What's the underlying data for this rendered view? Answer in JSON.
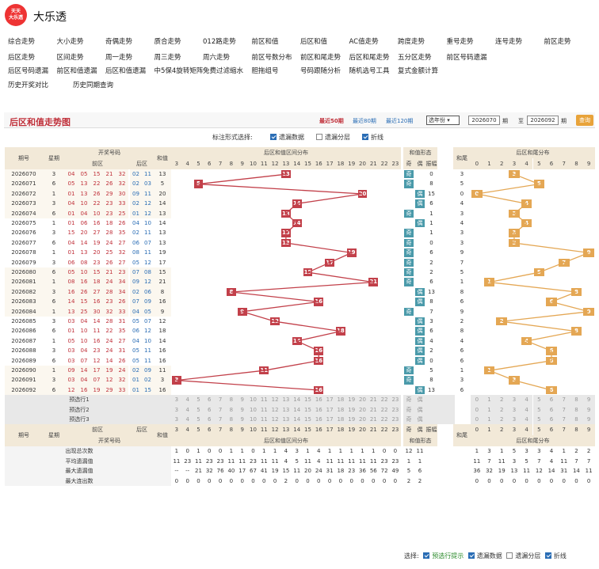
{
  "site": {
    "logo_lines": [
      "天天",
      "大乐透"
    ],
    "name": "大乐透"
  },
  "nav": [
    [
      "综合走势",
      "大小走势",
      "奇偶走势",
      "质合走势",
      "012路走势",
      "前区和值",
      "后区和值",
      "AC值走势",
      "跨度走势",
      "重号走势",
      "连号走势",
      "前区走势"
    ],
    [
      "后区走势",
      "区间走势",
      "周一走势",
      "周三走势",
      "周六走势",
      "前区号数分布",
      "前区和尾走势",
      "后区和尾走势",
      "五分区走势",
      "前区号码遗漏"
    ],
    [
      "后区号码遗漏",
      "前区和值遗漏",
      "后区和值遗漏",
      "中5保4旋转矩阵",
      "免费过滤缩水",
      "胆拖组号",
      "号码跟随分析",
      "随机选号工具",
      "复式金额计算"
    ],
    [
      "历史开奖对比",
      "历史同期查询"
    ]
  ],
  "title": "后区和值走势图",
  "period_tabs": [
    "最近50期",
    "最近80期",
    "最近120期"
  ],
  "year_select": "选年份",
  "range": {
    "from": "2026070",
    "sep1": "期",
    "to_label": "至",
    "to": "2026092",
    "sep2": "期",
    "query": "查询"
  },
  "options": {
    "label": "标注形式选择:",
    "items": [
      {
        "label": "遗漏数据",
        "checked": true
      },
      {
        "label": "遗漏分层",
        "checked": false
      },
      {
        "label": "折线",
        "checked": true
      }
    ]
  },
  "headers": {
    "period": "期号",
    "week": "星期",
    "kaijiang": "开奖号码",
    "front": "前区",
    "back": "后区",
    "sum": "和值",
    "dist": "后区和值区间分布",
    "shape": "和值形态",
    "odd": "奇",
    "even": "偶",
    "amp": "振幅",
    "tail": "和尾",
    "taildist": "后区和尾分布"
  },
  "dist_nums": [
    "3",
    "4",
    "5",
    "6",
    "7",
    "8",
    "9",
    "10",
    "11",
    "12",
    "13",
    "14",
    "15",
    "16",
    "17",
    "18",
    "19",
    "20",
    "21",
    "22",
    "23"
  ],
  "tail_nums": [
    "0",
    "1",
    "2",
    "3",
    "4",
    "5",
    "6",
    "7",
    "8",
    "9"
  ],
  "rows": [
    {
      "p": "2026070",
      "w": "3",
      "f": [
        "04",
        "05",
        "15",
        "21",
        "32"
      ],
      "b": [
        "02",
        "11"
      ],
      "s": 13,
      "amp": "0",
      "tail": "3"
    },
    {
      "p": "2026071",
      "w": "6",
      "f": [
        "05",
        "13",
        "22",
        "26",
        "32"
      ],
      "b": [
        "02",
        "03"
      ],
      "s": 5,
      "amp": "8",
      "tail": "5"
    },
    {
      "p": "2026072",
      "w": "1",
      "f": [
        "01",
        "13",
        "26",
        "29",
        "30"
      ],
      "b": [
        "09",
        "11"
      ],
      "s": 20,
      "amp": "15",
      "tail": "0"
    },
    {
      "p": "2026073",
      "w": "3",
      "f": [
        "04",
        "10",
        "22",
        "23",
        "33"
      ],
      "b": [
        "02",
        "12"
      ],
      "s": 14,
      "amp": "6",
      "tail": "4"
    },
    {
      "p": "2026074",
      "w": "6",
      "f": [
        "01",
        "04",
        "10",
        "23",
        "25"
      ],
      "b": [
        "01",
        "12"
      ],
      "s": 13,
      "amp": "1",
      "tail": "3"
    },
    {
      "p": "2026075",
      "w": "1",
      "f": [
        "01",
        "06",
        "16",
        "18",
        "26"
      ],
      "b": [
        "04",
        "10"
      ],
      "s": 14,
      "amp": "1",
      "tail": "4"
    },
    {
      "p": "2026076",
      "w": "3",
      "f": [
        "15",
        "20",
        "27",
        "28",
        "35"
      ],
      "b": [
        "02",
        "11"
      ],
      "s": 13,
      "amp": "1",
      "tail": "3"
    },
    {
      "p": "2026077",
      "w": "6",
      "f": [
        "04",
        "14",
        "19",
        "24",
        "27"
      ],
      "b": [
        "06",
        "07"
      ],
      "s": 13,
      "amp": "0",
      "tail": "3"
    },
    {
      "p": "2026078",
      "w": "1",
      "f": [
        "01",
        "13",
        "20",
        "25",
        "32"
      ],
      "b": [
        "08",
        "11"
      ],
      "s": 19,
      "amp": "6",
      "tail": "9"
    },
    {
      "p": "2026079",
      "w": "3",
      "f": [
        "06",
        "08",
        "23",
        "26",
        "27"
      ],
      "b": [
        "05",
        "12"
      ],
      "s": 17,
      "amp": "2",
      "tail": "7"
    },
    {
      "p": "2026080",
      "w": "6",
      "f": [
        "05",
        "10",
        "15",
        "21",
        "23"
      ],
      "b": [
        "07",
        "08"
      ],
      "s": 15,
      "amp": "2",
      "tail": "5"
    },
    {
      "p": "2026081",
      "w": "1",
      "f": [
        "08",
        "16",
        "18",
        "24",
        "34"
      ],
      "b": [
        "09",
        "12"
      ],
      "s": 21,
      "amp": "6",
      "tail": "1"
    },
    {
      "p": "2026082",
      "w": "3",
      "f": [
        "16",
        "26",
        "27",
        "28",
        "34"
      ],
      "b": [
        "02",
        "06"
      ],
      "s": 8,
      "amp": "13",
      "tail": "8"
    },
    {
      "p": "2026083",
      "w": "6",
      "f": [
        "14",
        "15",
        "16",
        "23",
        "26"
      ],
      "b": [
        "07",
        "09"
      ],
      "s": 16,
      "amp": "8",
      "tail": "6"
    },
    {
      "p": "2026084",
      "w": "1",
      "f": [
        "13",
        "25",
        "30",
        "32",
        "33"
      ],
      "b": [
        "04",
        "05"
      ],
      "s": 9,
      "amp": "7",
      "tail": "9"
    },
    {
      "p": "2026085",
      "w": "3",
      "f": [
        "03",
        "04",
        "14",
        "28",
        "31"
      ],
      "b": [
        "05",
        "07"
      ],
      "s": 12,
      "amp": "3",
      "tail": "2"
    },
    {
      "p": "2026086",
      "w": "6",
      "f": [
        "01",
        "10",
        "11",
        "22",
        "35"
      ],
      "b": [
        "06",
        "12"
      ],
      "s": 18,
      "amp": "6",
      "tail": "8"
    },
    {
      "p": "2026087",
      "w": "1",
      "f": [
        "05",
        "10",
        "16",
        "24",
        "27"
      ],
      "b": [
        "04",
        "10"
      ],
      "s": 14,
      "amp": "4",
      "tail": "4"
    },
    {
      "p": "2026088",
      "w": "3",
      "f": [
        "03",
        "04",
        "23",
        "24",
        "31"
      ],
      "b": [
        "05",
        "11"
      ],
      "s": 16,
      "amp": "2",
      "tail": "6"
    },
    {
      "p": "2026089",
      "w": "6",
      "f": [
        "03",
        "07",
        "12",
        "14",
        "26"
      ],
      "b": [
        "05",
        "11"
      ],
      "s": 16,
      "amp": "0",
      "tail": "6"
    },
    {
      "p": "2026090",
      "w": "1",
      "f": [
        "09",
        "14",
        "17",
        "19",
        "24"
      ],
      "b": [
        "02",
        "09"
      ],
      "s": 11,
      "amp": "5",
      "tail": "1"
    },
    {
      "p": "2026091",
      "w": "3",
      "f": [
        "03",
        "04",
        "07",
        "12",
        "32"
      ],
      "b": [
        "01",
        "02"
      ],
      "s": 3,
      "amp": "8",
      "tail": "3"
    },
    {
      "p": "2026092",
      "w": "6",
      "f": [
        "12",
        "16",
        "19",
        "29",
        "33"
      ],
      "b": [
        "01",
        "15"
      ],
      "s": 16,
      "amp": "13",
      "tail": "6"
    }
  ],
  "predict": [
    "预选行1",
    "预选行2",
    "预选行3"
  ],
  "stats": [
    {
      "label": "出现总次数",
      "vals": [
        "1",
        "0",
        "1",
        "0",
        "0",
        "1",
        "1",
        "0",
        "1",
        "1",
        "4",
        "3",
        "1",
        "4",
        "1",
        "1",
        "1",
        "1",
        "1",
        "0",
        "0"
      ],
      "shape": [
        "12",
        "11"
      ],
      "tail": [
        "1",
        "3",
        "1",
        "5",
        "3",
        "3",
        "4",
        "1",
        "2",
        "2"
      ]
    },
    {
      "label": "平均遗漏值",
      "vals": [
        "11",
        "23",
        "11",
        "23",
        "23",
        "11",
        "11",
        "23",
        "11",
        "11",
        "4",
        "5",
        "11",
        "4",
        "11",
        "11",
        "11",
        "11",
        "11",
        "23",
        "23"
      ],
      "shape": [
        "1",
        "1"
      ],
      "tail": [
        "11",
        "7",
        "11",
        "3",
        "5",
        "7",
        "4",
        "11",
        "7",
        "7"
      ]
    },
    {
      "label": "最大遗漏值",
      "vals": [
        "--",
        "--",
        "21",
        "32",
        "76",
        "40",
        "17",
        "67",
        "41",
        "19",
        "15",
        "11",
        "20",
        "24",
        "31",
        "18",
        "23",
        "36",
        "56",
        "72",
        "49"
      ],
      "shape": [
        "5",
        "6"
      ],
      "tail": [
        "36",
        "32",
        "19",
        "13",
        "11",
        "12",
        "14",
        "31",
        "14",
        "11"
      ]
    },
    {
      "label": "最大连出数",
      "vals": [
        "0",
        "0",
        "0",
        "0",
        "0",
        "0",
        "0",
        "0",
        "0",
        "0",
        "2",
        "0",
        "0",
        "0",
        "0",
        "0",
        "0",
        "0",
        "0",
        "0",
        "0"
      ],
      "shape": [
        "2",
        "2"
      ],
      "tail": [
        "0",
        "0",
        "0",
        "0",
        "0",
        "0",
        "0",
        "0",
        "0",
        "0"
      ]
    }
  ],
  "footer": {
    "label": "选择:",
    "items": [
      "预选行提示",
      "遗漏数据",
      "遗漏分层",
      "折线"
    ]
  },
  "colors": {
    "ball": "#c2404a",
    "tail_ball": "#e4a754",
    "header": "#f2e9d8",
    "odd_even": "#4a9aaa"
  }
}
